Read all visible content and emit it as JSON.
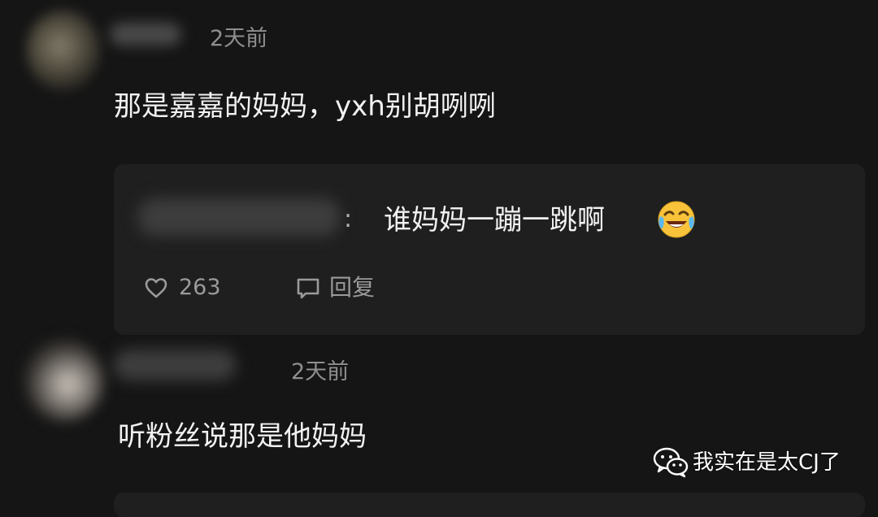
{
  "comments": [
    {
      "username": "",
      "time": "2天前",
      "text": "那是嘉嘉的妈妈，yxh别胡咧咧",
      "reply": {
        "username": "",
        "separator": ":",
        "text": "谁妈妈一蹦一跳啊",
        "emoji_icon": "crying-laughing-emoji-icon"
      },
      "likes": "263",
      "reply_label": "回复"
    },
    {
      "username": "",
      "time": "2天前",
      "text": "听粉丝说那是他妈妈"
    }
  ],
  "watermark": {
    "icon": "wechat-icon",
    "text": "我实在是太CJ了"
  },
  "colors": {
    "background": "#151515",
    "reply_box": "#1f1f1f",
    "secondary_text": "#8f8f8f",
    "primary_text": "#f2f2f2"
  }
}
